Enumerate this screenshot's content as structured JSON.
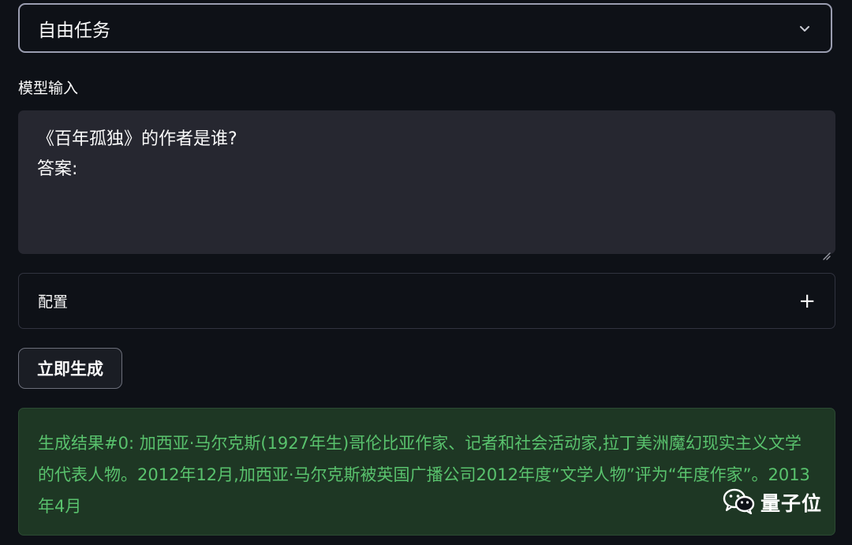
{
  "task_select": {
    "value": "自由任务",
    "icon": "chevron-down-icon"
  },
  "input": {
    "label": "模型输入",
    "line1": "《百年孤独》的作者是谁?",
    "line2": "答案:"
  },
  "config": {
    "label": "配置",
    "toggle_symbol": "+"
  },
  "generate_button": {
    "label": "立即生成"
  },
  "result": {
    "text": "生成结果#0: 加西亚·马尔克斯(1927年生)哥伦比亚作家、记者和社会活动家,拉丁美洲魔幻现实主义文学的代表人物。2012年12月,加西亚·马尔克斯被英国广播公司2012年度“文学人物”评为“年度作家”。2013年4月"
  },
  "watermark": {
    "icon": "wechat-icon",
    "text": "量子位"
  }
}
